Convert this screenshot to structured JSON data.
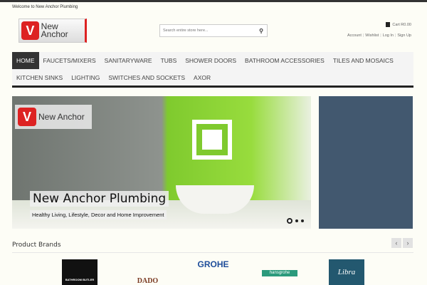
{
  "header": {
    "welcome": "Welcome to New Anchor Plumbing",
    "logo_text": "New Anchor",
    "search_placeholder": "Search entire store here...",
    "cart": "Cart R0.00",
    "links": [
      "Account",
      "Wishlist",
      "Log In",
      "Sign Up"
    ]
  },
  "nav": {
    "row1": [
      "HOME",
      "FAUCETS/MIXERS",
      "SANITARYWARE",
      "TUBS",
      "SHOWER DOORS",
      "BATHROOM ACCESSORIES",
      "TILES AND MOSAICS"
    ],
    "row2": [
      "KITCHEN SINKS",
      "LIGHTING",
      "SWITCHES AND SOCKETS",
      "AXOR"
    ]
  },
  "slider": {
    "title": "New Anchor Plumbing",
    "subtitle": "Healthy Living, Lifestyle, Decor and Home Improvement",
    "slide_count": 3,
    "active_slide": 1
  },
  "brands": {
    "title": "Product Brands",
    "prev": "‹",
    "next": "›",
    "items": [
      "BATHROOM BUTLER",
      "DADO",
      "GROHE",
      "hansgrohe",
      "Libra"
    ]
  }
}
